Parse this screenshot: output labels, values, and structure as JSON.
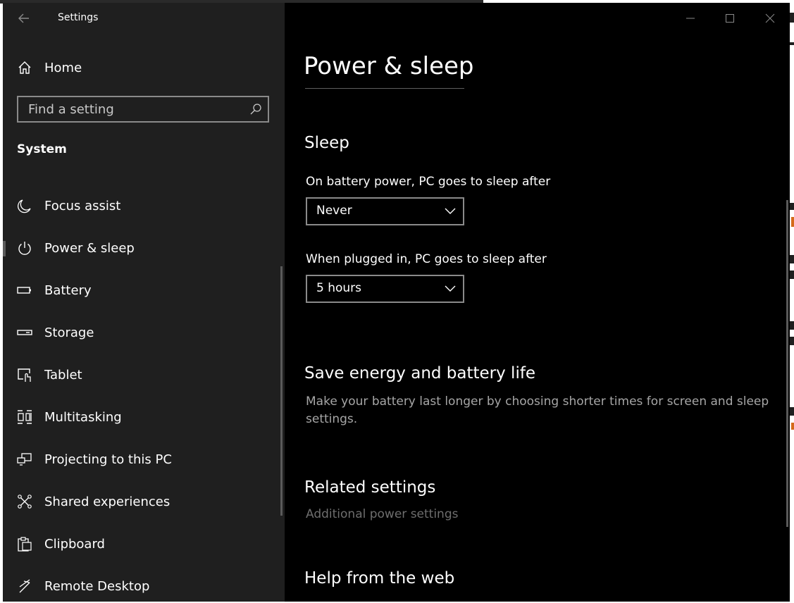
{
  "window": {
    "title": "Settings",
    "controls": {
      "minimize": "minimize-icon",
      "maximize": "maximize-icon",
      "close": "close-icon"
    }
  },
  "sidebar": {
    "home_label": "Home",
    "search": {
      "placeholder": "Find a setting"
    },
    "section": "System",
    "items": [
      {
        "label": "Focus assist",
        "icon": "moon-icon"
      },
      {
        "label": "Power & sleep",
        "icon": "power-icon",
        "active": true
      },
      {
        "label": "Battery",
        "icon": "battery-icon"
      },
      {
        "label": "Storage",
        "icon": "storage-icon"
      },
      {
        "label": "Tablet",
        "icon": "tablet-icon"
      },
      {
        "label": "Multitasking",
        "icon": "multitasking-icon"
      },
      {
        "label": "Projecting to this PC",
        "icon": "projecting-icon"
      },
      {
        "label": "Shared experiences",
        "icon": "shared-experiences-icon"
      },
      {
        "label": "Clipboard",
        "icon": "clipboard-icon"
      },
      {
        "label": "Remote Desktop",
        "icon": "remote-desktop-icon"
      }
    ]
  },
  "main": {
    "title": "Power & sleep",
    "sleep": {
      "heading": "Sleep",
      "battery_label": "On battery power, PC goes to sleep after",
      "battery_value": "Never",
      "plugged_label": "When plugged in, PC goes to sleep after",
      "plugged_value": "5 hours"
    },
    "save_energy": {
      "heading": "Save energy and battery life",
      "description": "Make your battery last longer by choosing shorter times for screen and sleep settings."
    },
    "related": {
      "heading": "Related settings",
      "link": "Additional power settings"
    },
    "help": {
      "heading": "Help from the web"
    }
  },
  "colors": {
    "sidebar_bg": "#1f1f1f",
    "content_bg": "#000000",
    "muted_text": "#a6a6a6",
    "disabled_link": "#6e6e6e"
  }
}
